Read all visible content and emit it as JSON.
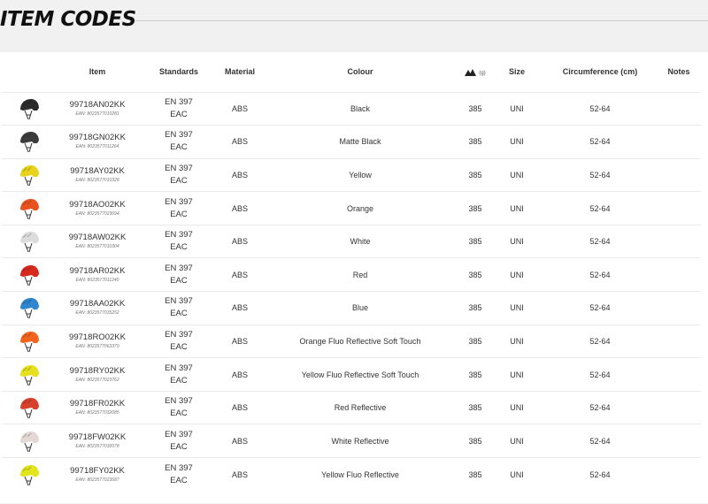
{
  "page": {
    "title": "ITEM CODES"
  },
  "table": {
    "columns": {
      "item": "Item",
      "standards": "Standards",
      "material": "Material",
      "colour": "Colour",
      "weight_unit": "(g)",
      "size": "Size",
      "circumference": "Circumference (cm)",
      "notes": "Notes"
    },
    "rows": [
      {
        "code": "99718AN02KK",
        "ean": "EAN: 8023577010281",
        "std1": "EN 397",
        "std2": "EAC",
        "material": "ABS",
        "colour": "Black",
        "weight": "385",
        "size": "UNI",
        "circumference": "52-64",
        "notes": "",
        "helmet_color": "#2b2b2b"
      },
      {
        "code": "99718GN02KK",
        "ean": "EAN: 8023577011264",
        "std1": "EN 397",
        "std2": "EAC",
        "material": "ABS",
        "colour": "Matte Black",
        "weight": "385",
        "size": "UNI",
        "circumference": "52-64",
        "notes": "",
        "helmet_color": "#3c3c3c"
      },
      {
        "code": "99718AY02KK",
        "ean": "EAN: 8023577010328",
        "std1": "EN 397",
        "std2": "EAC",
        "material": "ABS",
        "colour": "Yellow",
        "weight": "385",
        "size": "UNI",
        "circumference": "52-64",
        "notes": "",
        "helmet_color": "#e8d21c"
      },
      {
        "code": "99718AO02KK",
        "ean": "EAN: 8023577023694",
        "std1": "EN 397",
        "std2": "EAC",
        "material": "ABS",
        "colour": "Orange",
        "weight": "385",
        "size": "UNI",
        "circumference": "52-64",
        "notes": "",
        "helmet_color": "#e8541f"
      },
      {
        "code": "99718AW02KK",
        "ean": "EAN: 8023577010304",
        "std1": "EN 397",
        "std2": "EAC",
        "material": "ABS",
        "colour": "White",
        "weight": "385",
        "size": "UNI",
        "circumference": "52-64",
        "notes": "",
        "helmet_color": "#dcdcdc"
      },
      {
        "code": "99718AR02KK",
        "ean": "EAN: 8023577011240",
        "std1": "EN 397",
        "std2": "EAC",
        "material": "ABS",
        "colour": "Red",
        "weight": "385",
        "size": "UNI",
        "circumference": "52-64",
        "notes": "",
        "helmet_color": "#d72a1f"
      },
      {
        "code": "99718AA02KK",
        "ean": "EAN: 8023577035252",
        "std1": "EN 397",
        "std2": "EAC",
        "material": "ABS",
        "colour": "Blue",
        "weight": "385",
        "size": "UNI",
        "circumference": "52-64",
        "notes": "",
        "helmet_color": "#2f86cf"
      },
      {
        "code": "99718RO02KK",
        "ean": "EAN: 8023577063379",
        "std1": "EN 397",
        "std2": "EAC",
        "material": "ABS",
        "colour": "Orange Fluo Reflective Soft Touch",
        "weight": "385",
        "size": "UNI",
        "circumference": "52-64",
        "notes": "",
        "helmet_color": "#f0641e"
      },
      {
        "code": "99718RY02KK",
        "ean": "EAN: 8023577023762",
        "std1": "EN 397",
        "std2": "EAC",
        "material": "ABS",
        "colour": "Yellow Fluo Reflective Soft Touch",
        "weight": "385",
        "size": "UNI",
        "circumference": "52-64",
        "notes": "",
        "helmet_color": "#e6e01e"
      },
      {
        "code": "99718FR02KK",
        "ean": "EAN: 8023577032085",
        "std1": "EN 397",
        "std2": "EAC",
        "material": "ABS",
        "colour": "Red Reflective",
        "weight": "385",
        "size": "UNI",
        "circumference": "52-64",
        "notes": "",
        "helmet_color": "#d8402e"
      },
      {
        "code": "99718FW02KK",
        "ean": "EAN: 8023577032078",
        "std1": "EN 397",
        "std2": "EAC",
        "material": "ABS",
        "colour": "White Reflective",
        "weight": "385",
        "size": "UNI",
        "circumference": "52-64",
        "notes": "",
        "helmet_color": "#e4d8d4"
      },
      {
        "code": "99718FY02KK",
        "ean": "EAN: 8023577023687",
        "std1": "EN 397",
        "std2": "EAC",
        "material": "ABS",
        "colour": "Yellow Fluo Reflective",
        "weight": "385",
        "size": "UNI",
        "circumference": "52-64",
        "notes": "",
        "helmet_color": "#e2e51a"
      }
    ]
  }
}
